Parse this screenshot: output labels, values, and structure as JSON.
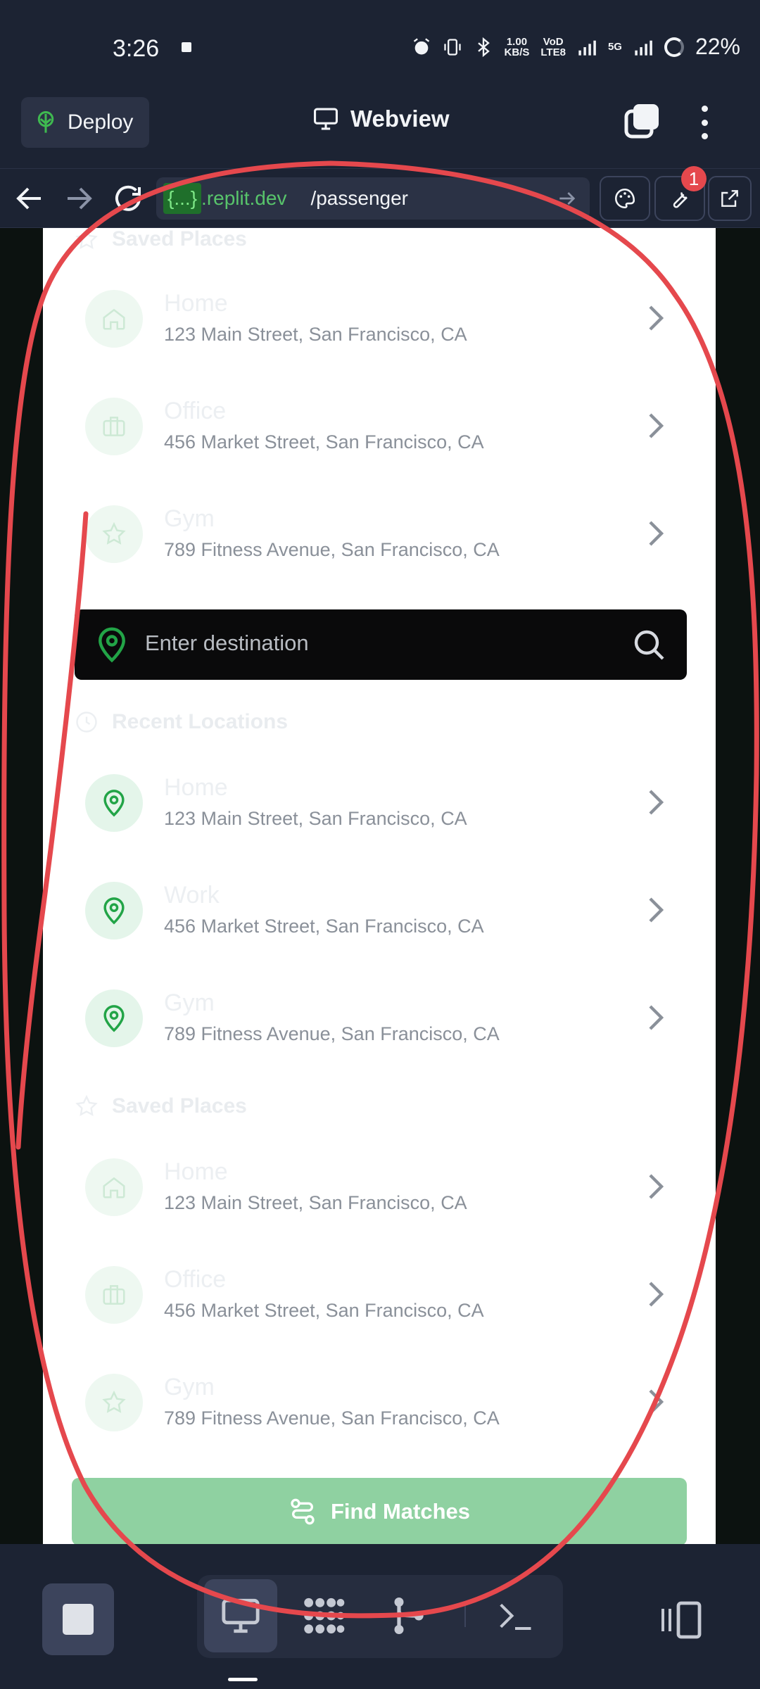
{
  "status_bar": {
    "time": "3:26",
    "net_speed_top": "1.00",
    "net_speed_bottom": "KB/S",
    "volte_top": "VoD",
    "volte_bottom": "LTE8",
    "network": "5G",
    "battery": "22%"
  },
  "toolbar": {
    "deploy_label": "Deploy",
    "title": "Webview"
  },
  "urlbar": {
    "repl_tag": "{...}",
    "domain": ".replit.dev",
    "path": "/passenger",
    "tools_badge": "1"
  },
  "page": {
    "saved_title": "Saved Places",
    "recent_title": "Recent Locations",
    "saved_places_top": [
      {
        "name": "Home",
        "address": "123 Main Street, San Francisco, CA",
        "icon": "home-icon"
      },
      {
        "name": "Office",
        "address": "456 Market Street, San Francisco, CA",
        "icon": "briefcase-icon"
      },
      {
        "name": "Gym",
        "address": "789 Fitness Avenue, San Francisco, CA",
        "icon": "star-icon"
      }
    ],
    "search_placeholder": "Enter destination",
    "recent_locations": [
      {
        "name": "Home",
        "address": "123 Main Street, San Francisco, CA",
        "icon": "map-pin-icon"
      },
      {
        "name": "Work",
        "address": "456 Market Street, San Francisco, CA",
        "icon": "map-pin-icon"
      },
      {
        "name": "Gym",
        "address": "789 Fitness Avenue, San Francisco, CA",
        "icon": "map-pin-icon"
      }
    ],
    "saved_places_bottom": [
      {
        "name": "Home",
        "address": "123 Main Street, San Francisco, CA",
        "icon": "home-icon"
      },
      {
        "name": "Office",
        "address": "456 Market Street, San Francisco, CA",
        "icon": "briefcase-icon"
      },
      {
        "name": "Gym",
        "address": "789 Fitness Avenue, San Francisco, CA",
        "icon": "star-icon"
      }
    ],
    "find_button": "Find Matches"
  },
  "colors": {
    "accent_green": "#22a447",
    "annotation_red": "#e5484d",
    "find_button_bg": "#8fd1a1"
  }
}
